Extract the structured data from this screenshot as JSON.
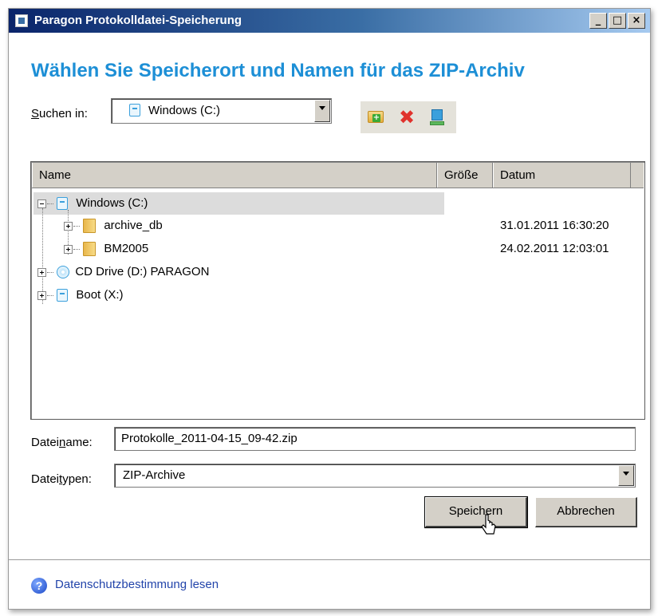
{
  "window": {
    "title": "Paragon Protokolldatei-Speicherung",
    "buttons": {
      "minimize": "_",
      "maximize": "□",
      "close": "×"
    }
  },
  "heading": "Wählen Sie Speicherort und Namen für das ZIP-Archiv",
  "look_in": {
    "label_first": "S",
    "label_rest": "uchen in:",
    "value": "Windows (C:)"
  },
  "toolbar": {
    "icons": [
      "new-folder-icon",
      "delete-icon",
      "map-network-drive-icon"
    ]
  },
  "file_list": {
    "columns": [
      "Name",
      "Größe",
      "Datum"
    ],
    "rows": [
      {
        "name": "Windows (C:)",
        "icon": "drive-icon",
        "date": ""
      },
      {
        "name": "archive_db",
        "icon": "folder-icon",
        "date": "31.01.2011 16:30:20"
      },
      {
        "name": "BM2005",
        "icon": "folder-icon",
        "date": "24.02.2011 12:03:01"
      },
      {
        "name": "CD Drive (D:) PARAGON",
        "icon": "cd-drive-icon",
        "date": ""
      },
      {
        "name": "Boot (X:)",
        "icon": "drive-icon",
        "date": ""
      }
    ]
  },
  "filename": {
    "label_a": "Datei",
    "label_u": "n",
    "label_b": "ame:",
    "value": "Protokolle_2011-04-15_09-42.zip"
  },
  "filetype": {
    "label_a": "Datei",
    "label_u": "t",
    "label_b": "ypen:",
    "value": "ZIP-Archive"
  },
  "buttons": {
    "save": "Speichern",
    "cancel": "Abbrechen"
  },
  "footer": {
    "help_icon": "?",
    "privacy_link": "Datenschutzbestimmung lesen"
  },
  "colors": {
    "heading": "#1d8fd6",
    "titlebar_start": "#0a246a",
    "titlebar_end": "#a6caf0",
    "link": "#2244aa"
  }
}
